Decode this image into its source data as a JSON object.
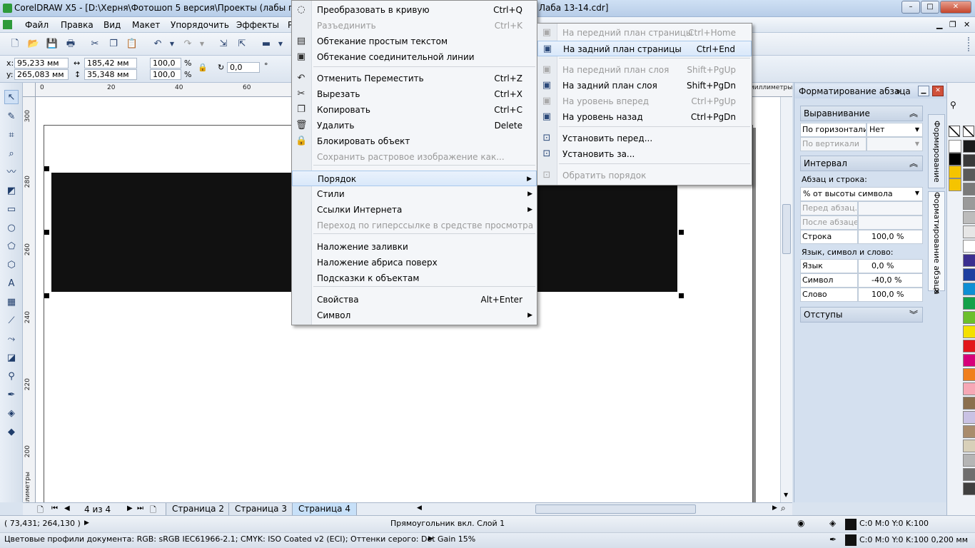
{
  "window": {
    "title": "CorelDRAW X5 - [D:\\Херня\\Фотошоп 5 версия\\Проекты (лабы по ПО д",
    "title_tail": "Лаба 13-14.cdr]",
    "min": "–",
    "max": "□",
    "close": "✕"
  },
  "menu": [
    "Файл",
    "Правка",
    "Вид",
    "Макет",
    "Упорядочить",
    "Эффекты",
    "Р"
  ],
  "props": {
    "x_label": "x:",
    "x": "95,233 мм",
    "y_label": "y:",
    "y": "265,083 мм",
    "w": "185,42 мм",
    "h": "35,348 мм",
    "sx": "100,0",
    "sy": "100,0",
    "pct": "%",
    "angle": "0,0",
    "deg": "°"
  },
  "rulers": {
    "h_ticks": [
      "0",
      "20",
      "40",
      "60"
    ],
    "h_units": "миллиметры",
    "v_ticks": [
      "300",
      "280",
      "260",
      "240",
      "220",
      "200"
    ],
    "v_units": "миллиметры"
  },
  "context_menu": {
    "items": [
      {
        "label": "Преобразовать в кривую",
        "shortcut": "Ctrl+Q",
        "icon": "convert-curve-icon",
        "glyph": "◌",
        "disabled": false
      },
      {
        "label": "Разъединить",
        "shortcut": "Ctrl+K",
        "icon": "",
        "glyph": "",
        "disabled": true
      },
      {
        "label": "Обтекание простым текстом",
        "shortcut": "",
        "icon": "text-wrap-icon",
        "glyph": "▤",
        "disabled": false
      },
      {
        "label": "Обтекание соединительной линии",
        "shortcut": "",
        "icon": "connector-wrap-icon",
        "glyph": "▣",
        "disabled": false
      },
      {
        "label": "Отменить Переместить",
        "shortcut": "Ctrl+Z",
        "icon": "undo-icon",
        "glyph": "↶",
        "disabled": false
      },
      {
        "label": "Вырезать",
        "shortcut": "Ctrl+X",
        "icon": "scissors-icon",
        "glyph": "✂",
        "disabled": false
      },
      {
        "label": "Копировать",
        "shortcut": "Ctrl+C",
        "icon": "copy-icon",
        "glyph": "❐",
        "disabled": false
      },
      {
        "label": "Удалить",
        "shortcut": "Delete",
        "icon": "trash-icon",
        "glyph": "🗑",
        "disabled": false
      },
      {
        "label": "Блокировать объект",
        "shortcut": "",
        "icon": "lock-icon",
        "glyph": "🔒",
        "disabled": false
      },
      {
        "label": "Сохранить растровое изображение как...",
        "shortcut": "",
        "icon": "",
        "glyph": "",
        "disabled": true
      },
      {
        "label": "Порядок",
        "shortcut": "",
        "icon": "",
        "glyph": "",
        "disabled": false,
        "submenu": true,
        "highlight": true
      },
      {
        "label": "Стили",
        "shortcut": "",
        "icon": "",
        "glyph": "",
        "disabled": false,
        "submenu": true
      },
      {
        "label": "Ссылки Интернета",
        "shortcut": "",
        "icon": "",
        "glyph": "",
        "disabled": false,
        "submenu": true
      },
      {
        "label": "Переход по гиперссылке в средстве просмотра",
        "shortcut": "",
        "icon": "",
        "glyph": "",
        "disabled": true
      },
      {
        "label": "Наложение заливки",
        "shortcut": "",
        "icon": "",
        "glyph": "",
        "disabled": false
      },
      {
        "label": "Наложение абриса поверх",
        "shortcut": "",
        "icon": "",
        "glyph": "",
        "disabled": false
      },
      {
        "label": "Подсказки к объектам",
        "shortcut": "",
        "icon": "",
        "glyph": "",
        "disabled": false
      },
      {
        "label": "Свойства",
        "shortcut": "Alt+Enter",
        "icon": "",
        "glyph": "",
        "disabled": false
      },
      {
        "label": "Символ",
        "shortcut": "",
        "icon": "",
        "glyph": "",
        "disabled": false,
        "submenu": true
      }
    ]
  },
  "order_submenu": {
    "items": [
      {
        "label": "На передний план страницы",
        "shortcut": "Ctrl+Home",
        "disabled": true,
        "glyph": "▣"
      },
      {
        "label": "На задний план страницы",
        "shortcut": "Ctrl+End",
        "disabled": false,
        "highlight": true,
        "glyph": "▣"
      },
      {
        "label": "На передний план слоя",
        "shortcut": "Shift+PgUp",
        "disabled": true,
        "glyph": "▣"
      },
      {
        "label": "На задний план слоя",
        "shortcut": "Shift+PgDn",
        "disabled": false,
        "glyph": "▣"
      },
      {
        "label": "На уровень вперед",
        "shortcut": "Ctrl+PgUp",
        "disabled": true,
        "glyph": "▣"
      },
      {
        "label": "На уровень назад",
        "shortcut": "Ctrl+PgDn",
        "disabled": false,
        "glyph": "▣"
      },
      {
        "label": "Установить перед...",
        "shortcut": "",
        "disabled": false,
        "glyph": "⊡"
      },
      {
        "label": "Установить за...",
        "shortcut": "",
        "disabled": false,
        "glyph": "⊡"
      },
      {
        "label": "Обратить порядок",
        "shortcut": "",
        "disabled": true,
        "glyph": "⊡"
      }
    ]
  },
  "docker": {
    "title": "Форматирование абзаца",
    "align_section": "Выравнивание",
    "horiz_label": "По горизонтали",
    "horiz_value": "Нет",
    "vert_label": "По вертикали",
    "spacing_section": "Интервал",
    "para_line_label": "Абзац и строка:",
    "para_line_mode": "% от высоты символа",
    "before_label": "Перед абзац...",
    "after_label": "После абзацев",
    "line_label": "Строка",
    "line_value": "100,0 %",
    "lang_label": "Язык, символ и слово:",
    "lang_row": "Язык",
    "lang_value": "0,0 %",
    "char_row": "Символ",
    "char_value": "-40,0 %",
    "word_row": "Слово",
    "word_value": "100,0 %",
    "indent_section": "Отступы",
    "vtab1": "Формирование",
    "vtab2": "Форматирование абзаца"
  },
  "palette": [
    "#ffffff",
    "#000000",
    "#f5c400",
    "#f5c400",
    "#1a1a1a",
    "#3a3a3a",
    "#5a5a5a",
    "#7a7a7a",
    "#9a9a9a",
    "#bcbcbc",
    "#e6e6e6",
    "#ffffff",
    "#3b2f8f",
    "#1e3fa0",
    "#0e8fd4",
    "#14a14a",
    "#6cbf2c",
    "#f4e000",
    "#e2161b",
    "#d6007a",
    "#f07f1d",
    "#f6a7b5",
    "#8b6f4e",
    "#c9c2e4",
    "#a98c6d",
    "#d8d0b9",
    "#b5b5b5",
    "#6e6e6e",
    "#404040"
  ],
  "pagebar": {
    "counter": "4 из 4",
    "tabs": [
      "Страница 2",
      "Страница 3",
      "Страница 4"
    ]
  },
  "status": {
    "coords": "( 73,431; 264,130 )",
    "object": "Прямоугольник вкл. Слой 1",
    "fill": "C:0 M:0 Y:0 K:100",
    "outline": "C:0 M:0 Y:0 K:100  0,200 мм",
    "profiles": "Цветовые профили документа: RGB: sRGB IEC61966-2.1; CMYK: ISO Coated v2 (ECI); Оттенки серого: Dot Gain 15%"
  }
}
